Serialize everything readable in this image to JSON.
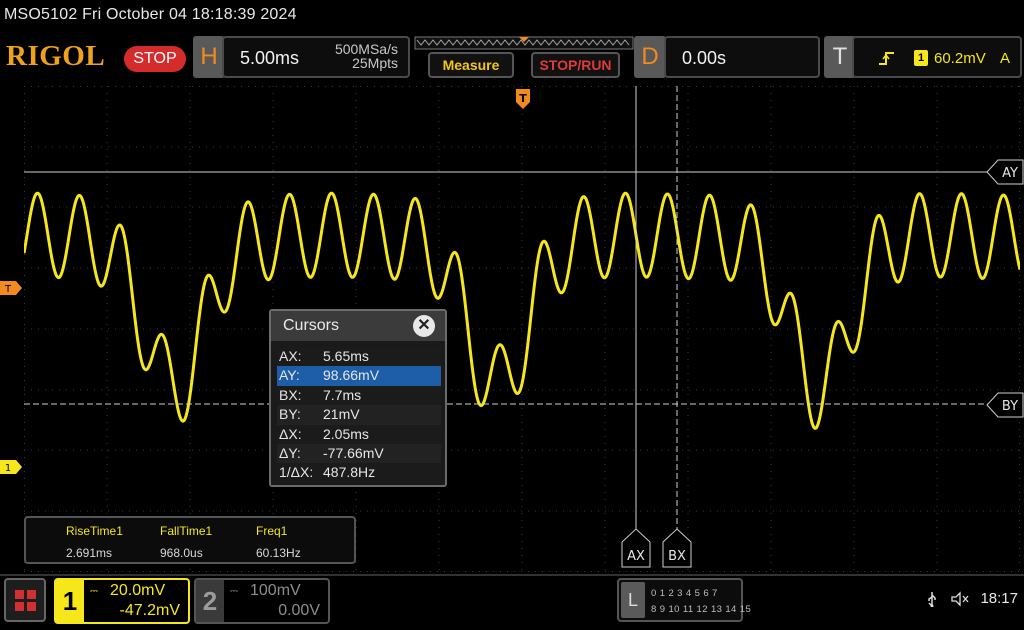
{
  "header": {
    "title_line": "MSO5102  Fri October 04 18:18:39 2024",
    "logo": "RIGOL",
    "run_state": "STOP"
  },
  "horizontal": {
    "tab": "H",
    "timebase": "5.00ms",
    "sample_rate": "500MSa/s",
    "memory_depth": "25Mpts"
  },
  "menu": {
    "measure": "Measure",
    "stop_run": "STOP/RUN"
  },
  "delay": {
    "tab": "D",
    "value": "0.00s"
  },
  "trigger": {
    "tab": "T",
    "edge_icon": "rising-edge-icon",
    "source": "1",
    "level": "60.2mV",
    "coupling": "A"
  },
  "markers": {
    "trigger_marker": "T",
    "channel1_marker": "1",
    "AY": "AY",
    "BY": "BY",
    "AX": "AX",
    "BX": "BX"
  },
  "cursors": {
    "title": "Cursors",
    "close": "✕",
    "rows": [
      {
        "k": "AX:",
        "v": "5.65ms"
      },
      {
        "k": "AY:",
        "v": "98.66mV",
        "selected": true
      },
      {
        "k": "BX:",
        "v": "7.7ms"
      },
      {
        "k": "BY:",
        "v": "21mV"
      },
      {
        "k": "ΔX:",
        "v": "2.05ms"
      },
      {
        "k": "ΔY:",
        "v": "-77.66mV"
      },
      {
        "k": "1/ΔX:",
        "v": "487.8Hz"
      }
    ]
  },
  "measurements": [
    {
      "name": "RiseTime1",
      "value": "2.691ms"
    },
    {
      "name": "FallTime1",
      "value": "968.0us"
    },
    {
      "name": "Freq1",
      "value": "60.13Hz"
    }
  ],
  "channel1": {
    "num": "1",
    "coupling_icon": "dc-coupling-icon",
    "scale": "20.0mV",
    "offset": "-47.2mV"
  },
  "channel2": {
    "num": "2",
    "coupling_icon": "dc-coupling-icon",
    "scale": "100mV",
    "offset": "0.00V"
  },
  "logic": {
    "label": "L",
    "row1": "0 1 2 3   4 5 6 7",
    "row2": "8 9 10 11 12 13 14 15"
  },
  "status": {
    "time": "18:17"
  },
  "colors": {
    "ch1": "#f5e71a",
    "accent": "#f28a20",
    "stop": "#d42b2b",
    "selected_row": "#1e5ea8"
  }
}
